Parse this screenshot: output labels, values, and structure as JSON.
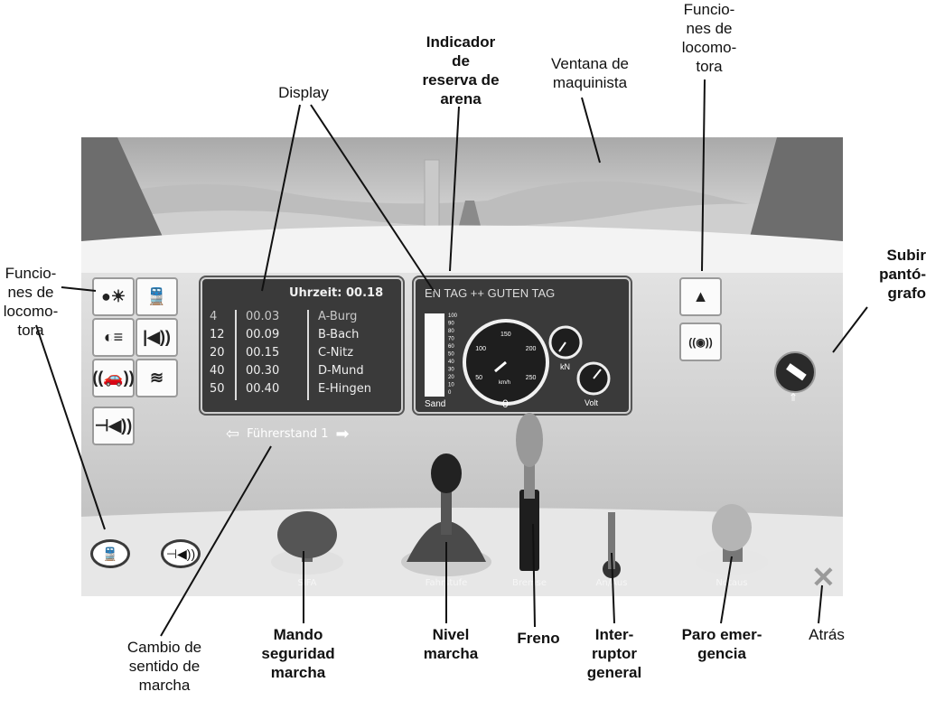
{
  "annotations": {
    "display": "Display",
    "sand_indicator": "Indicador\nde\nreserva de\narena",
    "driver_window": "Ventana de\nmaquinista",
    "loco_functions_top": "Funcio-\nnes de\nlocomo-\ntora",
    "loco_functions_left": "Funcio-\nnes de\nlocomo-\ntora",
    "pantograph": "Subir\npantó-\ngrafo",
    "direction_change": "Cambio de\nsentido de\nmarcha",
    "safety_control": "Mando\nseguridad\nmarcha",
    "drive_level": "Nivel\nmarcha",
    "brake": "Freno",
    "main_switch": "Inter-\nruptor\ngeneral",
    "emergency_stop": "Paro emer-\ngencia",
    "back": "Atrás"
  },
  "display": {
    "time_label": "Uhrzeit: 00.18",
    "rows": [
      {
        "num": "4",
        "time": "00.03",
        "station": "A-Burg"
      },
      {
        "num": "12",
        "time": "00.09",
        "station": "B-Bach"
      },
      {
        "num": "20",
        "time": "00.15",
        "station": "C-Nitz"
      },
      {
        "num": "40",
        "time": "00.30",
        "station": "D-Mund"
      },
      {
        "num": "50",
        "time": "00.40",
        "station": "E-Hingen"
      }
    ]
  },
  "gauges": {
    "ticker": "EN TAG ++ GUTEN TAG",
    "sand_label": "Sand",
    "speed_value": "0",
    "speed_unit": "km/h",
    "kn_label": "kN",
    "volt_label": "Volt",
    "sand_scale": [
      "100",
      "90",
      "80",
      "70",
      "60",
      "50",
      "40",
      "30",
      "20",
      "10",
      "0"
    ],
    "speed_ticks": [
      "50",
      "100",
      "150",
      "200",
      "250"
    ]
  },
  "controls": {
    "fuhrerstand": "Führerstand 1",
    "sifa": "SIFA",
    "fahrstufe": "Fahrstufe",
    "bremse": "Bremse",
    "an_aus": "An/Aus",
    "notaus": "Notaus"
  },
  "icons": {
    "headlight": "●☀",
    "loco": "🚆",
    "high_beam": "◐≡",
    "horn_high": "|◀))",
    "radio": "((🚗))",
    "wifi_signal": "≋",
    "horn": "⊣◀))",
    "pantograph": "▲",
    "signal_sound": "((◉))"
  },
  "colors": {
    "panel": "#3a3a3a",
    "dashboard": "#d7d7d7"
  }
}
